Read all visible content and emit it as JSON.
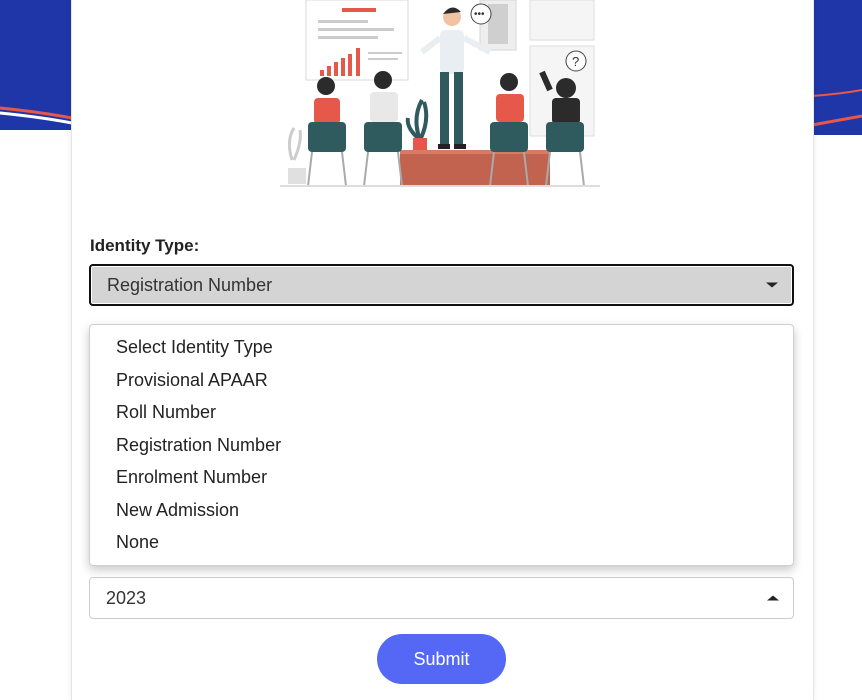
{
  "form": {
    "identity_label": "Identity Type:",
    "identity_selected": "Registration Number",
    "identity_options": [
      "Select Identity Type",
      "Provisional APAAR",
      "Roll Number",
      "Registration Number",
      "Enrolment Number",
      "New Admission",
      "None"
    ],
    "year_selected": "2023",
    "submit_label": "Submit"
  },
  "icons": {
    "identity_caret": "caret-down-icon",
    "year_caret": "caret-up-icon",
    "hero": "presentation-classroom-illustration"
  },
  "colors": {
    "brand_blue": "#1f36a8",
    "accent_red": "#e5584a",
    "submit_bg": "#5468f5"
  }
}
